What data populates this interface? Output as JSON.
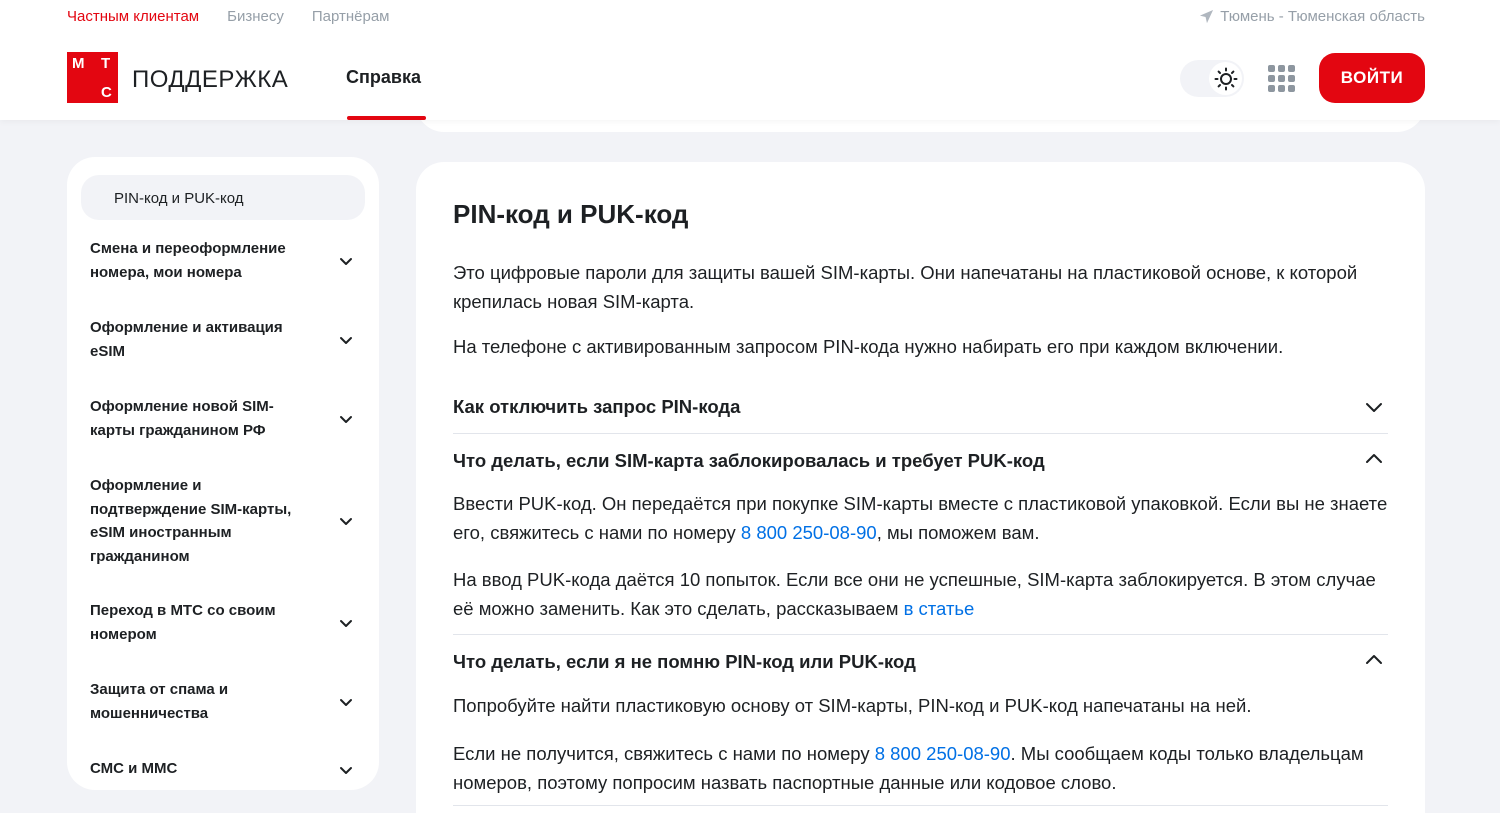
{
  "header": {
    "top_links": [
      "Частным клиентам",
      "Бизнесу",
      "Партнёрам"
    ],
    "region": "Тюмень - Тюменская область",
    "logo_letters": [
      "М",
      "Т",
      "С"
    ],
    "brand": "ПОДДЕРЖКА",
    "nav_help": "Справка",
    "login": "ВОЙТИ",
    "accent": "#e30611"
  },
  "sidebar": {
    "active": "PIN-код и PUK-код",
    "items": [
      {
        "label": "Смена и переоформление номера, мои номера"
      },
      {
        "label": "Оформление и активация eSIM"
      },
      {
        "label": "Оформление новой SIM-карты гражданином РФ"
      },
      {
        "label": "Оформление и подтверждение SIM-карты, eSIM иностранным гражданином"
      },
      {
        "label": "Переход в МТС со своим номером"
      },
      {
        "label": "Защита от спама и мошенничества"
      },
      {
        "label": "СМС и ММС"
      }
    ]
  },
  "article": {
    "title": "PIN-код и PUK-код",
    "intro1": "Это цифровые пароли для защиты вашей SIM-карты. Они напечатаны на пластиковой основе, к которой крепилась новая SIM-карта.",
    "intro2": "На телефоне с активированным запросом PIN-кода нужно набирать его при каждом включении.",
    "accordions": [
      {
        "title": "Как отключить запрос PIN-кода",
        "expanded": false
      },
      {
        "title": "Что делать, если SIM-карта заблокировалась и требует PUK-код",
        "expanded": true,
        "p1_before": "Ввести PUK-код. Он передаётся при покупке SIM-карты вместе с пластиковой упаковкой. Если вы не знаете его, свяжитесь с нами по номеру ",
        "p1_link": "8 800 250-08-90",
        "p1_after": ", мы поможем вам.",
        "p2_before": "На ввод PUK-кода даётся 10 попыток. Если все они не успешные, SIM-карта заблокируется. В этом случае её можно заменить. Как это сделать, рассказываем ",
        "p2_link": "в статье"
      },
      {
        "title": "Что делать, если я не помню PIN-код или PUK-код",
        "expanded": true,
        "p1": "Попробуйте найти пластиковую основу от SIM-карты, PIN-код и PUK-код напечатаны на ней.",
        "p2_before": "Если не получится, свяжитесь с нами по номеру ",
        "p2_link": "8 800 250-08-90",
        "p2_after": ". Мы сообщаем коды только владельцам номеров, поэтому попросим назвать паспортные данные или кодовое слово."
      }
    ]
  }
}
